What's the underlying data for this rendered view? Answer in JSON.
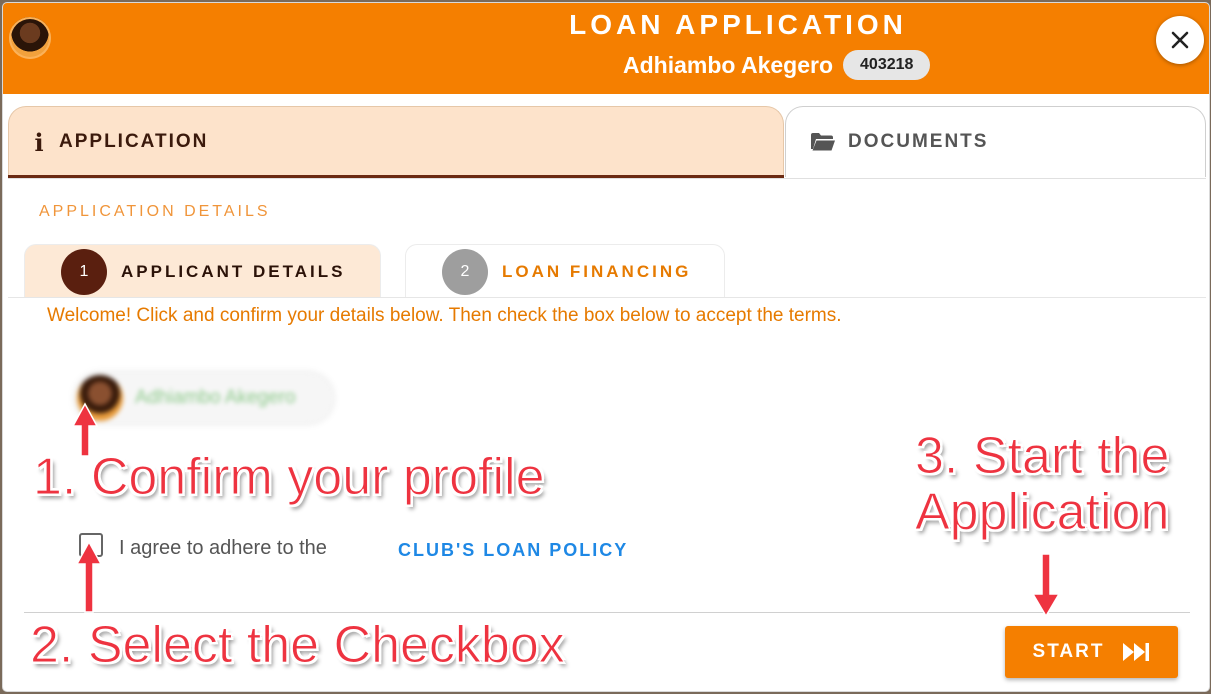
{
  "header": {
    "title": "LOAN APPLICATION",
    "member_name": "Adhiambo Akegero",
    "member_id": "403218",
    "close_icon": "close-icon",
    "accent_color": "#f57f00"
  },
  "tabs": [
    {
      "label": "APPLICATION",
      "icon": "info-icon",
      "active": true
    },
    {
      "label": "DOCUMENTS",
      "icon": "folder-open-icon",
      "active": false
    }
  ],
  "section": {
    "heading": "APPLICATION DETAILS"
  },
  "steps": [
    {
      "number": "1",
      "label": "APPLICANT DETAILS",
      "active": true
    },
    {
      "number": "2",
      "label": "LOAN FINANCING",
      "active": false
    }
  ],
  "welcome_text": "Welcome! Click and confirm your details below. Then check the box below to accept the terms.",
  "profile": {
    "name": "Adhiambo Akegero"
  },
  "agreement": {
    "text": "I agree to adhere to the",
    "link": "CLUB'S LOAN POLICY",
    "checked": false
  },
  "start_button": {
    "label": "START",
    "icon": "fast-forward-icon"
  },
  "annotations": {
    "step1": "1. Confirm your profile",
    "step2": "2. Select the Checkbox",
    "step3_line1": "3. Start the",
    "step3_line2": "Application",
    "color": "#ee3340"
  }
}
